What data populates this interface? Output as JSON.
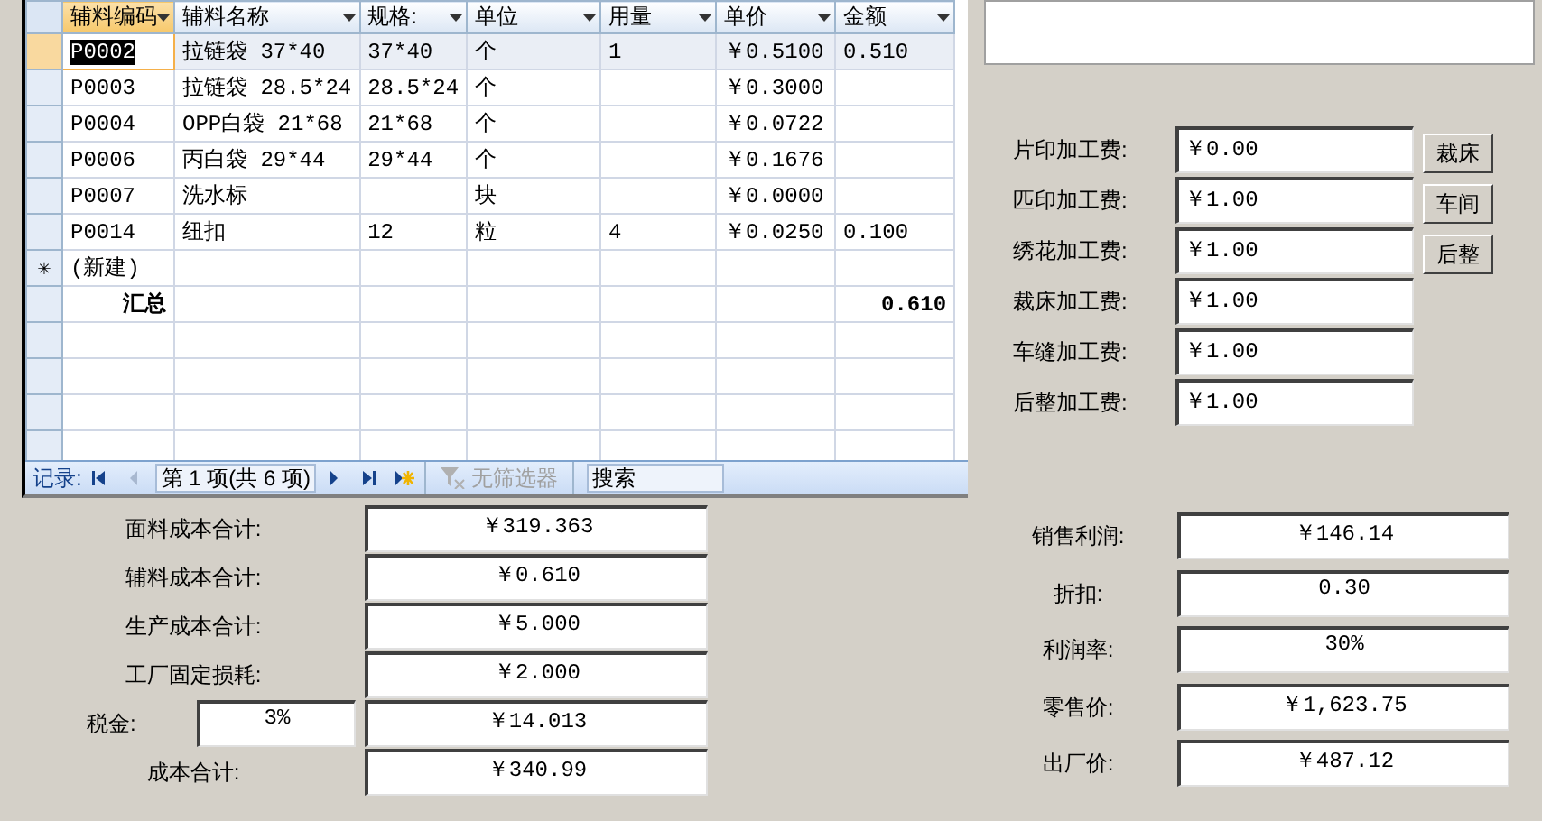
{
  "datasheet": {
    "columns": [
      {
        "label": "辅料编码",
        "selected": true
      },
      {
        "label": "辅料名称",
        "selected": false
      },
      {
        "label": "规格:",
        "selected": false
      },
      {
        "label": "单位",
        "selected": false
      },
      {
        "label": "用量",
        "selected": false
      },
      {
        "label": "单价",
        "selected": false
      },
      {
        "label": "金额",
        "selected": false
      }
    ],
    "rows": [
      {
        "cells": [
          "P0002",
          "拉链袋 37*40",
          "37*40",
          "个",
          "1",
          "￥0.5100",
          "0.510"
        ],
        "selected": true
      },
      {
        "cells": [
          "P0003",
          "拉链袋 28.5*24",
          "28.5*24",
          "个",
          "",
          "￥0.3000",
          ""
        ],
        "selected": false
      },
      {
        "cells": [
          "P0004",
          "OPP白袋 21*68",
          "21*68",
          "个",
          "",
          "￥0.0722",
          ""
        ],
        "selected": false
      },
      {
        "cells": [
          "P0006",
          "丙白袋 29*44",
          "29*44",
          "个",
          "",
          "￥0.1676",
          ""
        ],
        "selected": false
      },
      {
        "cells": [
          "P0007",
          "洗水标",
          "",
          "块",
          "",
          "￥0.0000",
          ""
        ],
        "selected": false
      },
      {
        "cells": [
          "P0014",
          "纽扣",
          "12",
          "粒",
          "4",
          "￥0.0250",
          "0.100"
        ],
        "selected": false
      }
    ],
    "new_row": {
      "marker": "✳",
      "label": "(新建)"
    },
    "total_row": {
      "label": "汇总",
      "amount": "0.610"
    },
    "navigation": {
      "label": "记录:",
      "position": "第 1 项(共 6 项)",
      "buttons": [
        {
          "kind": "first",
          "disabled": false
        },
        {
          "kind": "prev",
          "disabled": true
        },
        {
          "kind": "next",
          "disabled": false
        },
        {
          "kind": "last",
          "disabled": false
        },
        {
          "kind": "new",
          "disabled": false
        }
      ],
      "filter": {
        "label": "无筛选器",
        "disabled": true
      },
      "search": {
        "placeholder": "搜索"
      }
    }
  },
  "processing_fees": [
    {
      "label": "片印加工费:",
      "value": "￥0.00",
      "button": "裁床"
    },
    {
      "label": "匹印加工费:",
      "value": "￥1.00",
      "button": "车间"
    },
    {
      "label": "绣花加工费:",
      "value": "￥1.00",
      "button": "后整"
    },
    {
      "label": "裁床加工费:",
      "value": "￥1.00"
    },
    {
      "label": "车缝加工费:",
      "value": "￥1.00"
    },
    {
      "label": "后整加工费:",
      "value": "￥1.00"
    }
  ],
  "cost_summary": [
    {
      "label": "面料成本合计:",
      "value": "￥319.363"
    },
    {
      "label": "辅料成本合计:",
      "value": "￥0.610"
    },
    {
      "label": "生产成本合计:",
      "value": "￥5.000"
    },
    {
      "label": "工厂固定损耗:",
      "value": "￥2.000"
    },
    {
      "label": "税金:",
      "rate": "3%",
      "value": "￥14.013"
    },
    {
      "label": "成本合计:",
      "value": "￥340.99"
    }
  ],
  "price_summary": [
    {
      "label": "销售利润:",
      "value": "￥146.14"
    },
    {
      "label": "折扣:",
      "value": "0.30"
    },
    {
      "label": "利润率:",
      "value": "30%"
    },
    {
      "label": "零售价:",
      "value": "￥1,623.75"
    },
    {
      "label": "出厂价:",
      "value": "￥487.12"
    }
  ]
}
